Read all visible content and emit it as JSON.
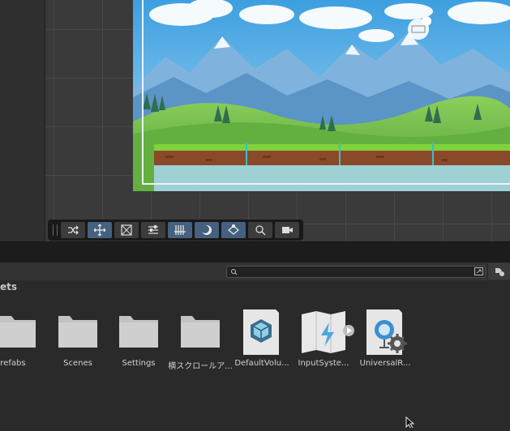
{
  "scene_toolbar": {
    "tools": [
      {
        "name": "view-tool-icon",
        "active": false
      },
      {
        "name": "move-tool-icon",
        "active": true
      },
      {
        "name": "rect-tool-icon",
        "active": false
      },
      {
        "name": "sorting-tool-icon",
        "active": false
      },
      {
        "name": "tilemap-tool-icon",
        "active": false
      },
      {
        "name": "light-tool-icon",
        "active": true
      },
      {
        "name": "layers-tool-icon",
        "active": true
      },
      {
        "name": "search-icon",
        "active": false
      },
      {
        "name": "camera-icon",
        "active": false
      }
    ]
  },
  "project": {
    "breadcrumb": "ets",
    "assets": [
      {
        "label": "Prefabs",
        "icon": "folder-icon"
      },
      {
        "label": "Scenes",
        "icon": "folder-icon"
      },
      {
        "label": "Settings",
        "icon": "folder-icon"
      },
      {
        "label": "横スクロールア...",
        "icon": "folder-icon"
      },
      {
        "label": "DefaultVolu...",
        "icon": "volume-profile-icon"
      },
      {
        "label": "InputSyste...",
        "icon": "input-actions-icon"
      },
      {
        "label": "UniversalR...",
        "icon": "render-pipeline-icon"
      }
    ]
  },
  "colors": {
    "toolbar_active": "#46607f",
    "panel_bg": "#2a2a2a",
    "sky": "#5fb3e6",
    "grass": "#7cc34b"
  }
}
